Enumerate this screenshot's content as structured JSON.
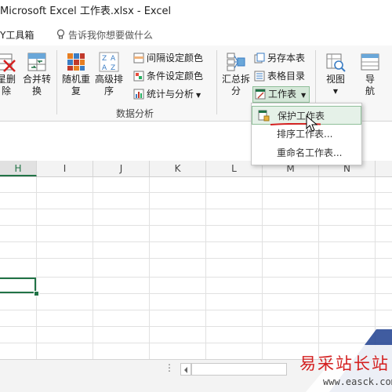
{
  "window": {
    "title": "Microsoft Excel 工作表.xlsx - Excel"
  },
  "tabs": {
    "diy_tab": "Y工具箱",
    "tell_me": "告诉我你想要做什么"
  },
  "ribbon": {
    "btn_delete": [
      "星删",
      "除"
    ],
    "btn_merge": [
      "合并转",
      "换"
    ],
    "btn_random": [
      "随机重",
      "复"
    ],
    "btn_sort": [
      "高级排",
      "序"
    ],
    "small_interval": "间隔设定颜色",
    "small_condition": "条件设定颜色",
    "small_stats": "统计与分析",
    "group_data": "数据分析",
    "btn_summary": [
      "汇总拆",
      "分"
    ],
    "small_saveas": "另存本表",
    "small_catalog": "表格目录",
    "small_sheet": "工作表",
    "btn_view": "视图",
    "btn_nav": "导",
    "btn_nav2": "航"
  },
  "menu": {
    "items": [
      {
        "label": "保护工作表",
        "hover": true
      },
      {
        "label": "排序工作表..."
      },
      {
        "label": "重命名工作表..."
      }
    ]
  },
  "grid": {
    "columns": [
      "H",
      "I",
      "J",
      "K",
      "L",
      "M",
      "N"
    ],
    "selected_column": "H"
  },
  "sheetbar": {
    "dots": "⋮"
  },
  "watermark": {
    "text": "易采站长站",
    "url": "www.easck.com"
  },
  "colors": {
    "excel_green": "#217346",
    "accent_red": "#d42020"
  }
}
